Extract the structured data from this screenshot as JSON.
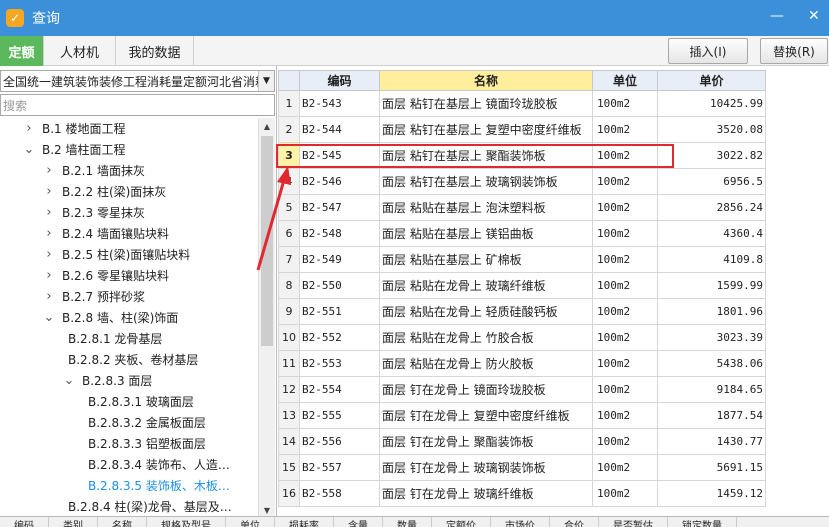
{
  "window": {
    "title": "查询",
    "min": "—",
    "close": "✕",
    "logo_icon": "app-logo-icon"
  },
  "tabs": [
    {
      "label": "定额",
      "active": true
    },
    {
      "label": "人材机",
      "active": false
    },
    {
      "label": "我的数据",
      "active": false
    }
  ],
  "buttons": {
    "insert": "插入(I)",
    "replace": "替换(R)"
  },
  "library_select": {
    "value": "全国统一建筑装饰装修工程消耗量定额河北省消耗"
  },
  "search": {
    "placeholder": "搜索"
  },
  "tree": [
    {
      "label": "B.1 楼地面工程",
      "chev": ">",
      "level": 0
    },
    {
      "label": "B.2 墙柱面工程",
      "chev": "v",
      "level": 0
    },
    {
      "label": "B.2.1 墙面抹灰",
      "chev": ">",
      "level": 1
    },
    {
      "label": "B.2.2 柱(梁)面抹灰",
      "chev": ">",
      "level": 1
    },
    {
      "label": "B.2.3 零星抹灰",
      "chev": ">",
      "level": 1
    },
    {
      "label": "B.2.4 墙面镶贴块料",
      "chev": ">",
      "level": 1
    },
    {
      "label": "B.2.5 柱(梁)面镶贴块料",
      "chev": ">",
      "level": 1
    },
    {
      "label": "B.2.6 零星镶贴块料",
      "chev": ">",
      "level": 1
    },
    {
      "label": "B.2.7 预拌砂浆",
      "chev": ">",
      "level": 1
    },
    {
      "label": "B.2.8 墙、柱(梁)饰面",
      "chev": "v",
      "level": 1
    },
    {
      "label": "B.2.8.1 龙骨基层",
      "chev": "",
      "level": 2
    },
    {
      "label": "B.2.8.2 夹板、卷材基层",
      "chev": "",
      "level": 2
    },
    {
      "label": "B.2.8.3 面层",
      "chev": "v",
      "level": 2
    },
    {
      "label": "B.2.8.3.1 玻璃面层",
      "chev": "",
      "level": 3
    },
    {
      "label": "B.2.8.3.2 金属板面层",
      "chev": "",
      "level": 3
    },
    {
      "label": "B.2.8.3.3 铝塑板面层",
      "chev": "",
      "level": 3
    },
    {
      "label": "B.2.8.3.4 装饰布、人造…",
      "chev": "",
      "level": 3
    },
    {
      "label": "B.2.8.3.5 装饰板、木板…",
      "chev": "",
      "level": 3,
      "selected": true
    },
    {
      "label": "B.2.8.4 柱(梁)龙骨、基层及…",
      "chev": "",
      "level": 2
    }
  ],
  "table": {
    "headers": {
      "code": "编码",
      "name": "名称",
      "unit": "单位",
      "price": "单价"
    },
    "rows": [
      {
        "idx": "1",
        "code": "B2-543",
        "name": "面层 粘钉在基层上 镜面玲珑胶板",
        "unit": "100m2",
        "price": "10425.99"
      },
      {
        "idx": "2",
        "code": "B2-544",
        "name": "面层 粘钉在基层上 复塑中密度纤维板",
        "unit": "100m2",
        "price": "3520.08"
      },
      {
        "idx": "3",
        "code": "B2-545",
        "name": "面层 粘钉在基层上 聚酯装饰板",
        "unit": "100m2",
        "price": "3022.82",
        "selected": true
      },
      {
        "idx": "4",
        "code": "B2-546",
        "name": "面层 粘钉在基层上 玻璃钢装饰板",
        "unit": "100m2",
        "price": "6956.5"
      },
      {
        "idx": "5",
        "code": "B2-547",
        "name": "面层 粘贴在基层上 泡沫塑料板",
        "unit": "100m2",
        "price": "2856.24"
      },
      {
        "idx": "6",
        "code": "B2-548",
        "name": "面层 粘贴在基层上 镁铝曲板",
        "unit": "100m2",
        "price": "4360.4"
      },
      {
        "idx": "7",
        "code": "B2-549",
        "name": "面层 粘贴在基层上 矿棉板",
        "unit": "100m2",
        "price": "4109.8"
      },
      {
        "idx": "8",
        "code": "B2-550",
        "name": "面层 粘贴在龙骨上 玻璃纤维板",
        "unit": "100m2",
        "price": "1599.99"
      },
      {
        "idx": "9",
        "code": "B2-551",
        "name": "面层 粘贴在龙骨上 轻质硅酸钙板",
        "unit": "100m2",
        "price": "1801.96"
      },
      {
        "idx": "10",
        "code": "B2-552",
        "name": "面层 粘贴在龙骨上 竹胶合板",
        "unit": "100m2",
        "price": "3023.39"
      },
      {
        "idx": "11",
        "code": "B2-553",
        "name": "面层 粘贴在龙骨上 防火胶板",
        "unit": "100m2",
        "price": "5438.06"
      },
      {
        "idx": "12",
        "code": "B2-554",
        "name": "面层 钉在龙骨上 镜面玲珑胶板",
        "unit": "100m2",
        "price": "9184.65"
      },
      {
        "idx": "13",
        "code": "B2-555",
        "name": "面层 钉在龙骨上 复塑中密度纤维板",
        "unit": "100m2",
        "price": "1877.54"
      },
      {
        "idx": "14",
        "code": "B2-556",
        "name": "面层 钉在龙骨上 聚酯装饰板",
        "unit": "100m2",
        "price": "1430.77"
      },
      {
        "idx": "15",
        "code": "B2-557",
        "name": "面层 钉在龙骨上 玻璃钢装饰板",
        "unit": "100m2",
        "price": "5691.15"
      },
      {
        "idx": "16",
        "code": "B2-558",
        "name": "面层 钉在龙骨上 玻璃纤维板",
        "unit": "100m2",
        "price": "1459.12"
      }
    ]
  },
  "bottom_strip": [
    "编码",
    "类别",
    "名称",
    "规格及型号",
    "单位",
    "损耗率",
    "含量",
    "数量",
    "定额价",
    "市场价",
    "合价",
    "是否暂估",
    "锁定数量"
  ],
  "colors": {
    "titlebar": "#3c8fd9",
    "active_tab": "#5cb85c",
    "highlight": "#e0282e",
    "name_header": "#ffef9c"
  }
}
